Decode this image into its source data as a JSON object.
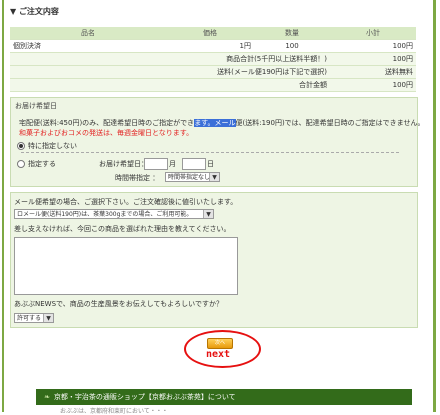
{
  "section_title": "▼ ご注文内容",
  "table": {
    "headers": [
      "品名",
      "価格",
      "数量",
      "小計"
    ],
    "rows": [
      {
        "name": "個別決済",
        "price": "1円",
        "qty": "100",
        "subtotal": "100円"
      }
    ],
    "summary": [
      {
        "label": "商品合計(5千円以上送料半額！)",
        "value": "100円"
      },
      {
        "label": "送料(メール便190円は下記で選択)",
        "value": "送料無料"
      },
      {
        "label": "合計金額",
        "value": "100円"
      }
    ]
  },
  "delivery": {
    "title": "お届け希望日",
    "note_before": "宅配便(送料:450円)のみ、配達希望日時のご指定ができ",
    "note_highlight": "ます。メール",
    "note_after": "便(送料:190円)では、配達希望日時のご指定はできません。",
    "note_red": "和菓子およびおコメの発送は、毎週金曜日となります。",
    "option_none": "特に指定しない",
    "option_specify": "指定する",
    "date_label": "お届け希望日：",
    "month_suffix": "月",
    "day_suffix": "日",
    "time_label": "時間帯指定 ：",
    "time_select": "時間帯指定なし"
  },
  "mail": {
    "prompt": "メール便希望の場合、ご選択下さい。ご注文確認後に値引いたします。",
    "select": "ロメール便(送料190円)は、茶葉300gまでの場合、ご利用可能。",
    "reason_label": "差し支えなければ、今回この商品を選ばれた理由を教えてください。"
  },
  "news": {
    "question": "あぶぶNEWSで、商品の生産風景をお伝えしてもよろしいですか？",
    "select": "許可する"
  },
  "next": {
    "button_label": "次へ",
    "annotation": "next"
  },
  "footer": {
    "title": "京都・宇治茶の通販ショップ【京都おぶぶ茶苑】について",
    "sub": "おぶぶは、京都府和束町において・・・"
  },
  "colors": {
    "accent_green": "#7da843",
    "panel_bg": "#eef5e4",
    "highlight": "#3b6fd8",
    "alert_red": "#e61010"
  }
}
